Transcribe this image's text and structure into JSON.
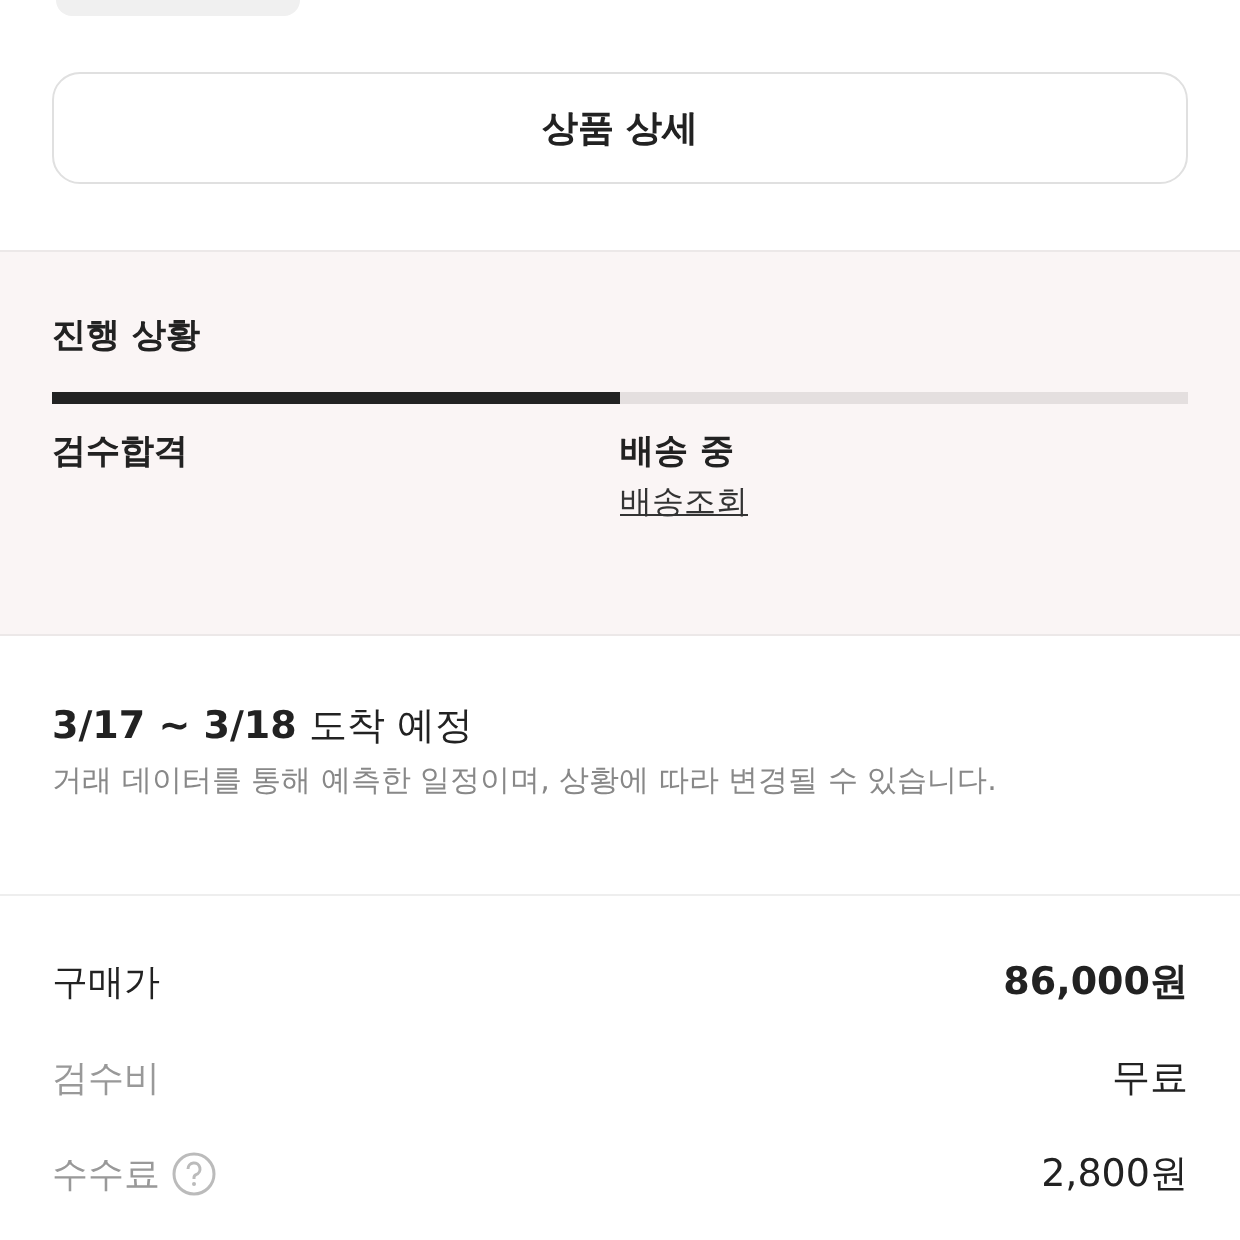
{
  "detail_button": {
    "label": "상품 상세"
  },
  "progress": {
    "title": "진행 상황",
    "level": 0.5,
    "stages": [
      {
        "label": "검수합격"
      },
      {
        "label": "배송 중",
        "link": "배송조회"
      }
    ]
  },
  "arrival": {
    "title": "3/17 ~ 3/18",
    "title_suffix": "도착 예정",
    "note": "거래 데이터를 통해 예측한 일정이며, 상황에 따라 변경될 수 있습니다."
  },
  "prices": [
    {
      "label": "구매가",
      "value": "86,000원",
      "emphasis": true,
      "help": false
    },
    {
      "label": "검수비",
      "value": "무료",
      "emphasis": false,
      "help": false
    },
    {
      "label": "수수료",
      "value": "2,800원",
      "emphasis": false,
      "help": true
    }
  ]
}
